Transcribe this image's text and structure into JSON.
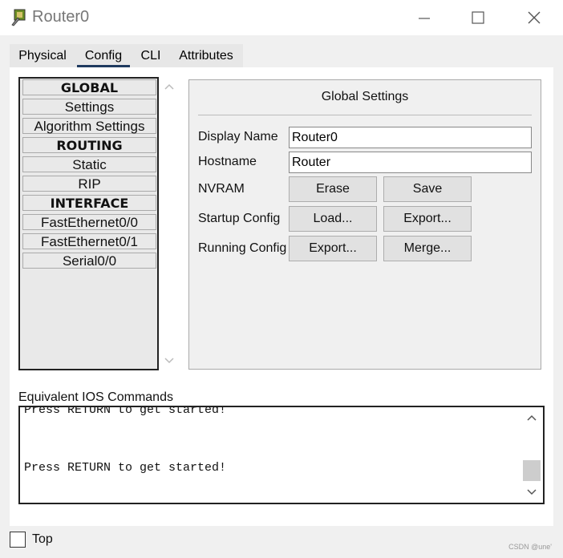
{
  "window": {
    "title": "Router0"
  },
  "tabs": [
    {
      "label": "Physical"
    },
    {
      "label": "Config",
      "active": true
    },
    {
      "label": "CLI"
    },
    {
      "label": "Attributes"
    }
  ],
  "sidebar": {
    "items": [
      {
        "label": "GLOBAL",
        "header": true
      },
      {
        "label": "Settings"
      },
      {
        "label": "Algorithm Settings"
      },
      {
        "label": "ROUTING",
        "header": true
      },
      {
        "label": "Static"
      },
      {
        "label": "RIP"
      },
      {
        "label": "INTERFACE",
        "header": true
      },
      {
        "label": "FastEthernet0/0"
      },
      {
        "label": "FastEthernet0/1"
      },
      {
        "label": "Serial0/0"
      }
    ]
  },
  "global_settings": {
    "title": "Global Settings",
    "display_name": {
      "label": "Display Name",
      "value": "Router0"
    },
    "hostname": {
      "label": "Hostname",
      "value": "Router"
    },
    "nvram": {
      "label": "NVRAM",
      "erase": "Erase",
      "save": "Save"
    },
    "startup_config": {
      "label": "Startup Config",
      "load": "Load...",
      "export": "Export..."
    },
    "running_config": {
      "label": "Running Config",
      "export": "Export...",
      "merge": "Merge..."
    }
  },
  "ios_commands": {
    "label": "Equivalent IOS Commands",
    "lines": [
      "Press RETURN to get started!",
      "",
      "",
      "Press RETURN to get started!"
    ]
  },
  "footer": {
    "top_label": "Top",
    "top_checked": false
  },
  "watermark": "CSDN @une'",
  "colors": {
    "active_tab_underline": "#1f3a5f"
  }
}
